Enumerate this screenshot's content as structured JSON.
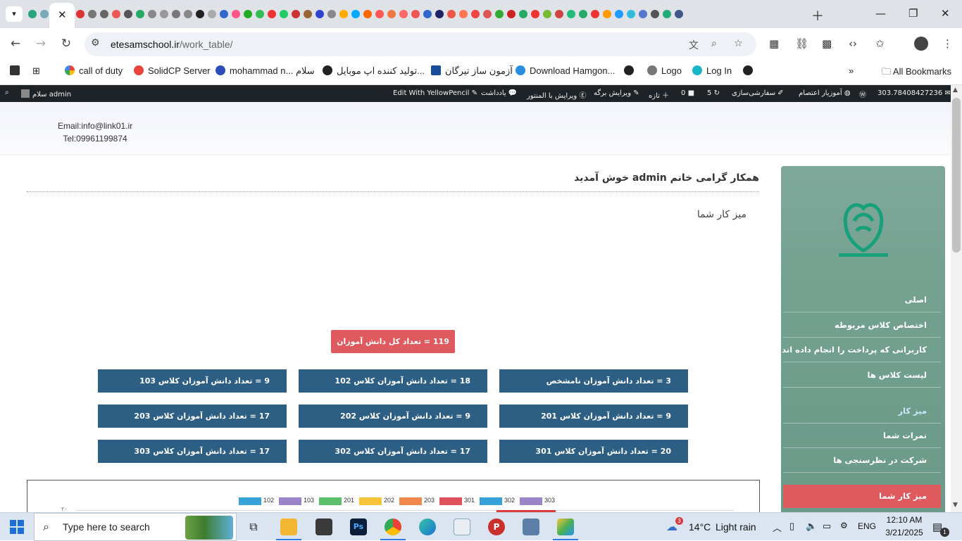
{
  "browser": {
    "url_host": "etesamschool.ir",
    "url_path": "/work_table/",
    "bookmarks": [
      "call of duty",
      "SolidCP Server",
      "mohammad n...",
      "سلام",
      "تولید کننده اپ موبایل...",
      "آزمون ساز تیرگان",
      "Download Hamgon...",
      "Logo",
      "Log In",
      "All Bookmarks"
    ]
  },
  "adminbar": {
    "greeting": "سلام admin",
    "yellowpencil": "Edit With YellowPencil",
    "notes": "یادداشت",
    "elementor": "ویرایش با المنتور",
    "edit_page": "ویرایش برگه",
    "new": "تازه",
    "comments_count": "0",
    "updates_count": "5",
    "customize": "سفارشی‌سازی",
    "site_name": "آموزیار اعتصام",
    "ip": "303.78408427236"
  },
  "header": {
    "email": "Email:info@link01.ir",
    "tel": "Tel:09961199874"
  },
  "main": {
    "welcome": "همکار گرامی خانم admin خوش آمدید",
    "desk_title": "میز کار شما",
    "total": "119 = تعداد کل دانش آموزان",
    "stats": [
      {
        "text": "9 = تعداد دانش آموزان کلاس 103"
      },
      {
        "text": "18 = تعداد دانش آموزان کلاس 102"
      },
      {
        "text": "3 = تعداد دانش آموزان نامشخص"
      },
      {
        "text": "17 = تعداد دانش آموزان کلاس 203"
      },
      {
        "text": "9 = تعداد دانش آموزان کلاس 202"
      },
      {
        "text": "9 = تعداد دانش آموزان کلاس 201"
      },
      {
        "text": "17 = تعداد دانش آموزان کلاس 303"
      },
      {
        "text": "17 = تعداد دانش آموزان کلاس 302"
      },
      {
        "text": "20 = تعداد دانش آموزان کلاس 301"
      }
    ]
  },
  "chart_data": {
    "type": "bar",
    "legend": [
      {
        "name": "102",
        "color": "#36a2d8"
      },
      {
        "name": "103",
        "color": "#9b84c8"
      },
      {
        "name": "201",
        "color": "#5cbf6b"
      },
      {
        "name": "202",
        "color": "#f7c339"
      },
      {
        "name": "203",
        "color": "#f0874c"
      },
      {
        "name": "301",
        "color": "#e0525b"
      },
      {
        "name": "302",
        "color": "#36a2d8"
      },
      {
        "name": "303",
        "color": "#9b84c8"
      }
    ],
    "y_top_tick": "۲۰"
  },
  "sidebar": {
    "items": [
      "اصلی",
      "اختصاص کلاس مربوطه",
      "کاربرانی که پرداخت را انجام داده اند",
      "لیست کلاس ها",
      "میز کار",
      "نمرات شما",
      "شرکت در نظرسنجی ها"
    ],
    "active": "میز کار شما",
    "highlight_color": "#cde8ff"
  },
  "taskbar": {
    "search_placeholder": "Type here to search",
    "weather_badge": "3",
    "temperature": "14°C",
    "weather": "Light rain",
    "lang": "ENG",
    "time": "12:10 AM",
    "date": "3/21/2025",
    "notif_count": "1"
  }
}
